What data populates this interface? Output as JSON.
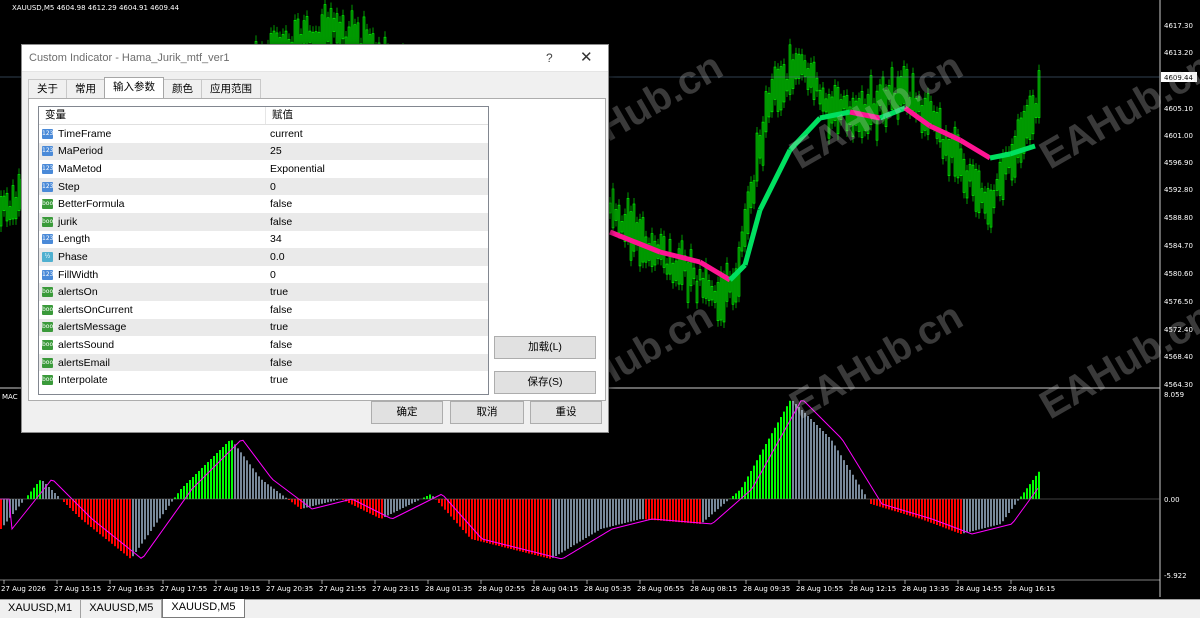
{
  "chart": {
    "symbol_header": "XAUUSD,M5  4604.98 4612.29 4604.91 4609.44",
    "indicator_label": "MAC",
    "current_price": "4609.44",
    "price_ticks": [
      "4617.30",
      "4613.20",
      "4605.10",
      "4601.00",
      "4596.90",
      "4592.80",
      "4588.80",
      "4584.70",
      "4580.60",
      "4576.50",
      "4572.40",
      "4568.40",
      "4564.30"
    ],
    "sub_ticks": [
      "8.059",
      "0.00",
      "-5.922"
    ],
    "time_ticks": [
      "27 Aug 2026",
      "27 Aug 15:15",
      "27 Aug 16:35",
      "27 Aug 17:55",
      "27 Aug 19:15",
      "27 Aug 20:35",
      "27 Aug 21:55",
      "27 Aug 23:15",
      "28 Aug 01:35",
      "28 Aug 02:55",
      "28 Aug 04:15",
      "28 Aug 05:35",
      "28 Aug 06:55",
      "28 Aug 08:15",
      "28 Aug 09:35",
      "28 Aug 10:55",
      "28 Aug 12:15",
      "28 Aug 13:35",
      "28 Aug 14:55",
      "28 Aug 16:15"
    ],
    "watermark": "EAHub.cn",
    "colors": {
      "bull": "#00ff00",
      "bear": "#ff0000",
      "flat": "#778899",
      "ma_up": "#00e060",
      "ma_down": "#ff1493",
      "signal": "#ff00ff"
    }
  },
  "chart_tabs": [
    {
      "label": "XAUUSD,M1",
      "active": false
    },
    {
      "label": "XAUUSD,M5",
      "active": false
    },
    {
      "label": "XAUUSD,M5",
      "active": true
    }
  ],
  "dialog": {
    "title": "Custom Indicator - Hama_Jurik_mtf_ver1",
    "help": "?",
    "close": "✕",
    "tabs": [
      "关于",
      "常用",
      "输入参数",
      "颜色",
      "应用范围"
    ],
    "active_tab": "输入参数",
    "col_variable": "变量",
    "col_value": "赋值",
    "params": [
      {
        "name": "TimeFrame",
        "value": "current",
        "type": "123"
      },
      {
        "name": "MaPeriod",
        "value": "25",
        "type": "123"
      },
      {
        "name": "MaMetod",
        "value": "Exponential",
        "type": "123"
      },
      {
        "name": "Step",
        "value": "0",
        "type": "123"
      },
      {
        "name": "BetterFormula",
        "value": "false",
        "type": "bool"
      },
      {
        "name": "jurik",
        "value": "false",
        "type": "bool"
      },
      {
        "name": "Length",
        "value": "34",
        "type": "123"
      },
      {
        "name": "Phase",
        "value": "0.0",
        "type": "½"
      },
      {
        "name": "FillWidth",
        "value": "0",
        "type": "123"
      },
      {
        "name": "alertsOn",
        "value": "true",
        "type": "bool"
      },
      {
        "name": "alertsOnCurrent",
        "value": "false",
        "type": "bool"
      },
      {
        "name": "alertsMessage",
        "value": "true",
        "type": "bool"
      },
      {
        "name": "alertsSound",
        "value": "false",
        "type": "bool"
      },
      {
        "name": "alertsEmail",
        "value": "false",
        "type": "bool"
      },
      {
        "name": "Interpolate",
        "value": "true",
        "type": "bool"
      }
    ],
    "load_button": "加载(L)",
    "save_button": "保存(S)",
    "ok_button": "确定",
    "cancel_button": "取消",
    "reset_button": "重设"
  }
}
